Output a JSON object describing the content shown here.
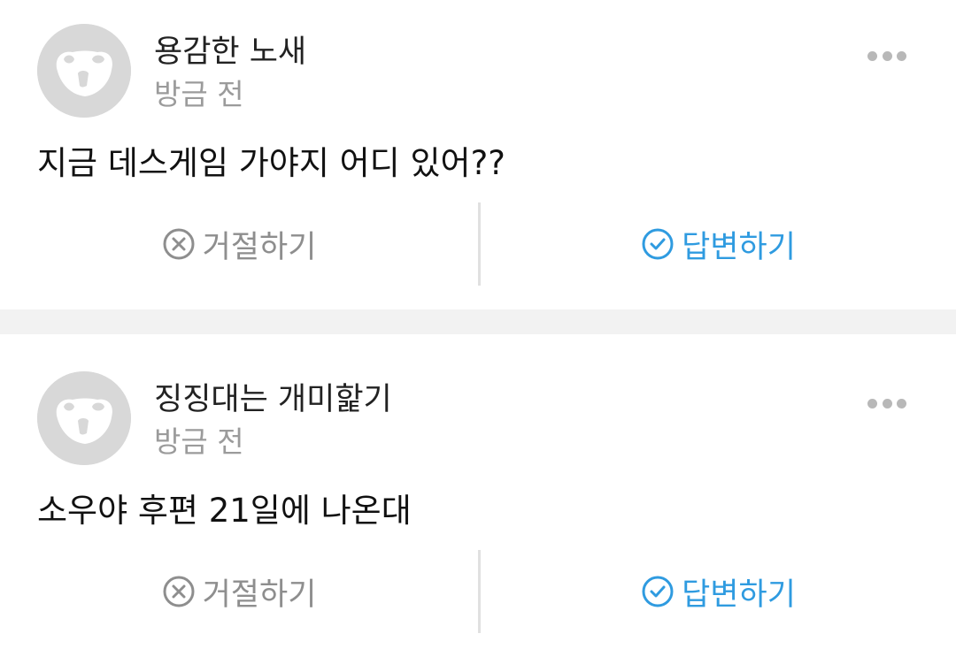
{
  "messages": [
    {
      "name": "용감한 노새",
      "time": "방금 전",
      "text": "지금 데스게임 가야지 어디 있어??",
      "reject_label": "거절하기",
      "reply_label": "답변하기"
    },
    {
      "name": "징징대는 개미핥기",
      "time": "방금 전",
      "text": "소우야 후편 21일에 나온대",
      "reject_label": "거절하기",
      "reply_label": "답변하기"
    }
  ],
  "colors": {
    "reply_accent": "#2f9be0",
    "reject_gray": "#8e8e8e",
    "avatar_bg": "#d8d8d8",
    "separator": "#f2f2f2"
  },
  "icons": {
    "avatar": "animal-silhouette-icon",
    "more": "more-dots-icon",
    "reject": "x-circle-icon",
    "reply": "check-circle-icon"
  }
}
